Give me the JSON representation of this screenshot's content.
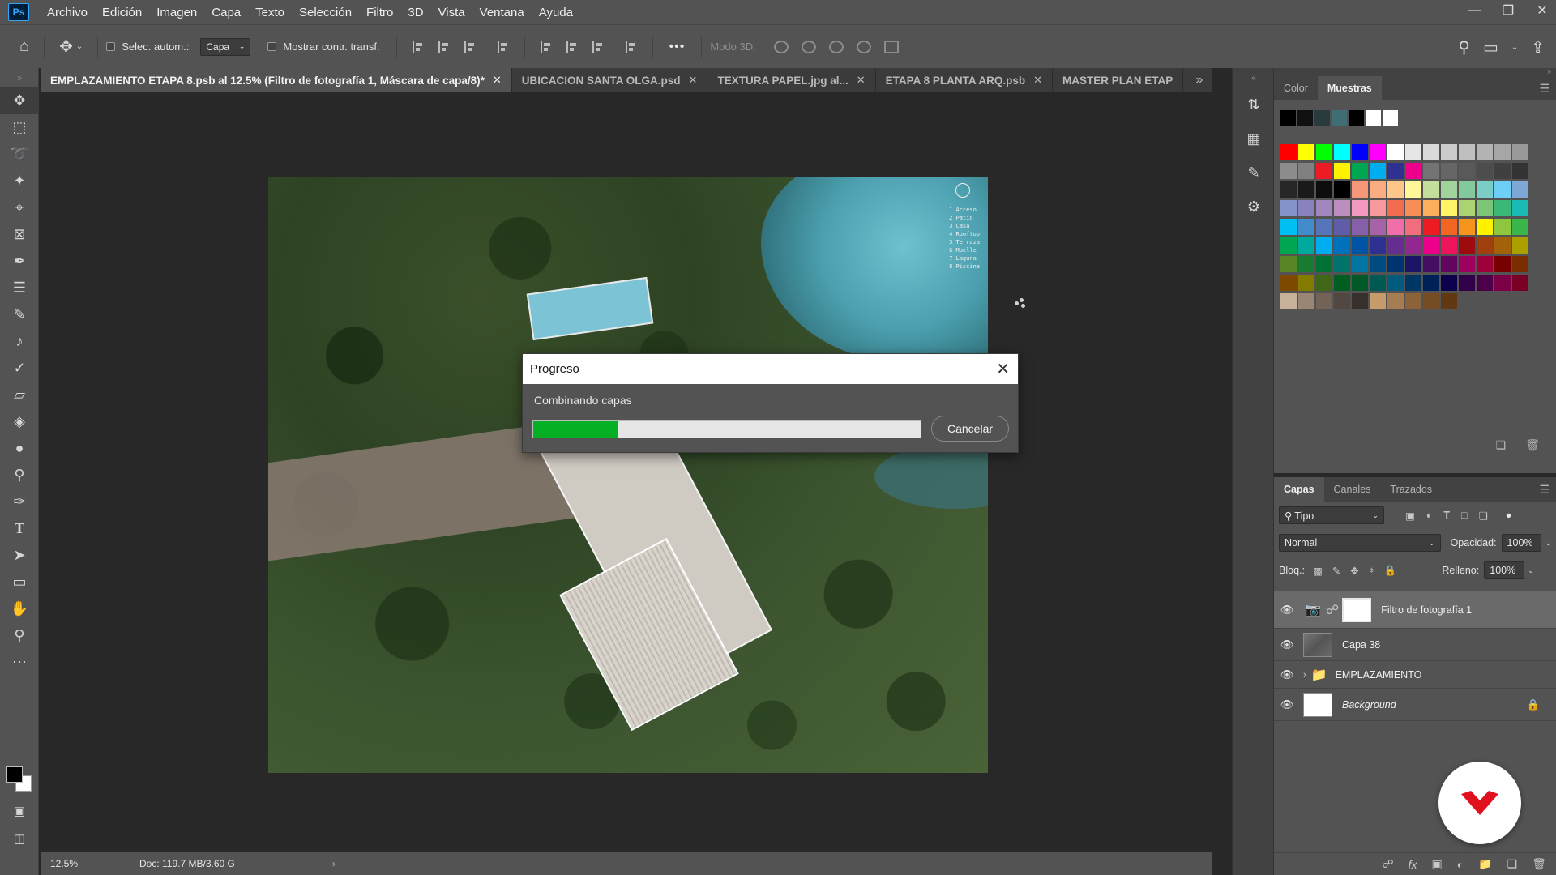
{
  "menu": [
    "Archivo",
    "Edición",
    "Imagen",
    "Capa",
    "Texto",
    "Selección",
    "Filtro",
    "3D",
    "Vista",
    "Ventana",
    "Ayuda"
  ],
  "app_logo": "Ps",
  "options": {
    "auto_select_label": "Selec. autom.:",
    "auto_select_value": "Capa",
    "transform_label": "Mostrar contr. transf.",
    "mode3d_label": "Modo 3D:",
    "more_icon": "•••"
  },
  "tabs": [
    {
      "label": "EMPLAZAMIENTO ETAPA 8.psb al 12.5% (Filtro de fotografía 1, Máscara de capa/8)",
      "suffix": " *"
    },
    {
      "label": "UBICACION SANTA OLGA.psd"
    },
    {
      "label": "TEXTURA PAPEL.jpg al..."
    },
    {
      "label": "ETAPA 8 PLANTA ARQ.psb"
    },
    {
      "label": "MASTER PLAN ETAP"
    }
  ],
  "canvas": {
    "legend": [
      "1 Acceso",
      "2 Patio",
      "3 Casa",
      "4 Rooftop",
      "5 Terraza",
      "6 Muelle",
      "7 Laguna",
      "8 Piscina"
    ]
  },
  "dialog": {
    "title": "Progreso",
    "message": "Combinando capas",
    "progress": 0.22,
    "cancel_label": "Cancelar",
    "progress_color": "#06b025"
  },
  "status": {
    "zoom": "12.5%",
    "doc_info": "Doc: 119.7 MB/3.60 G"
  },
  "swatch_panel": {
    "tabs": [
      "Color",
      "Muestras"
    ],
    "active_tab": "Muestras",
    "recent": [
      "#000000",
      "#111111",
      "#2a3b3d",
      "#3f6f74",
      "#000000",
      "#ffffff",
      "#ffffff"
    ],
    "grid": [
      [
        "#ff0000",
        "#ffff00",
        "#00ff00",
        "#00ffff",
        "#0000ff",
        "#ff00ff",
        "#ffffff",
        "#e6e6e6",
        "#d9d9d9",
        "#cccccc",
        "#bfbfbf",
        "#b3b3b3",
        "#a6a6a6",
        "#999999"
      ],
      [
        "#8c8c8c",
        "#808080",
        "#ed1c24",
        "#fff200",
        "#00a651",
        "#00aeef",
        "#2e3192",
        "#ec008c",
        "#737373",
        "#666666",
        "#595959",
        "#4d4d4d",
        "#404040",
        "#333333"
      ],
      [
        "#262626",
        "#1a1a1a",
        "#0d0d0d",
        "#000000",
        "#f7977a",
        "#f9ad81",
        "#fdc68a",
        "#fff79a",
        "#c4df9b",
        "#a3d39c",
        "#82ca9d",
        "#7bcdc8",
        "#6ecff6",
        "#7ea7d8"
      ],
      [
        "#8493ca",
        "#8882be",
        "#a187be",
        "#bc8dbf",
        "#f49ac2",
        "#f6989d",
        "#f26c4f",
        "#f68e55",
        "#fbaf5c",
        "#fff467",
        "#acd372",
        "#7cc576",
        "#3bb878",
        "#1abbb4"
      ],
      [
        "#00bff3",
        "#438ccb",
        "#5574b9",
        "#605ca8",
        "#855fa8",
        "#a763a8",
        "#f06ea9",
        "#f26d7d",
        "#ed1c24",
        "#f26522",
        "#f7941d",
        "#fff200",
        "#8dc63f",
        "#39b54a"
      ],
      [
        "#00a651",
        "#00a99d",
        "#00aeef",
        "#0072bc",
        "#0054a6",
        "#2e3192",
        "#662d91",
        "#92278f",
        "#ec008c",
        "#ed145b",
        "#9e0b0f",
        "#a0410d",
        "#a36209",
        "#aba000"
      ],
      [
        "#598527",
        "#197b30",
        "#007236",
        "#00746b",
        "#0076a3",
        "#004b80",
        "#003471",
        "#1b1464",
        "#440e62",
        "#630460",
        "#9e005d",
        "#9e0039",
        "#790000",
        "#7b2e00"
      ],
      [
        "#7d4900",
        "#827b00",
        "#406618",
        "#005e20",
        "#005826",
        "#005952",
        "#005b7f",
        "#003663",
        "#002157",
        "#0d004c",
        "#32004b",
        "#4b0049",
        "#7b0046",
        "#7a0026"
      ],
      [
        "#c7b299",
        "#998675",
        "#736357",
        "#534741",
        "#37302d",
        "#c69c6d",
        "#a67c52",
        "#8c6239",
        "#754c24",
        "#603913"
      ]
    ]
  },
  "layers_panel": {
    "tabs": [
      "Capas",
      "Canales",
      "Trazados"
    ],
    "active_tab": "Capas",
    "filter_label": "Tipo",
    "blend_mode": "Normal",
    "opacity_label": "Opacidad:",
    "opacity_value": "100%",
    "lock_label": "Bloq.:",
    "fill_label": "Relleno:",
    "fill_value": "100%",
    "layers": [
      {
        "name": "Filtro de fotografía 1",
        "type": "adjustment",
        "active": true
      },
      {
        "name": "Capa 38",
        "type": "pixel"
      },
      {
        "name": "EMPLAZAMIENTO",
        "type": "group"
      },
      {
        "name": "Background",
        "type": "background",
        "locked": true
      }
    ]
  },
  "colors": {
    "panel_bg": "#535353",
    "canvas_bg": "#282828",
    "accent": "#31a8ff",
    "badge_red": "#e0101f"
  }
}
